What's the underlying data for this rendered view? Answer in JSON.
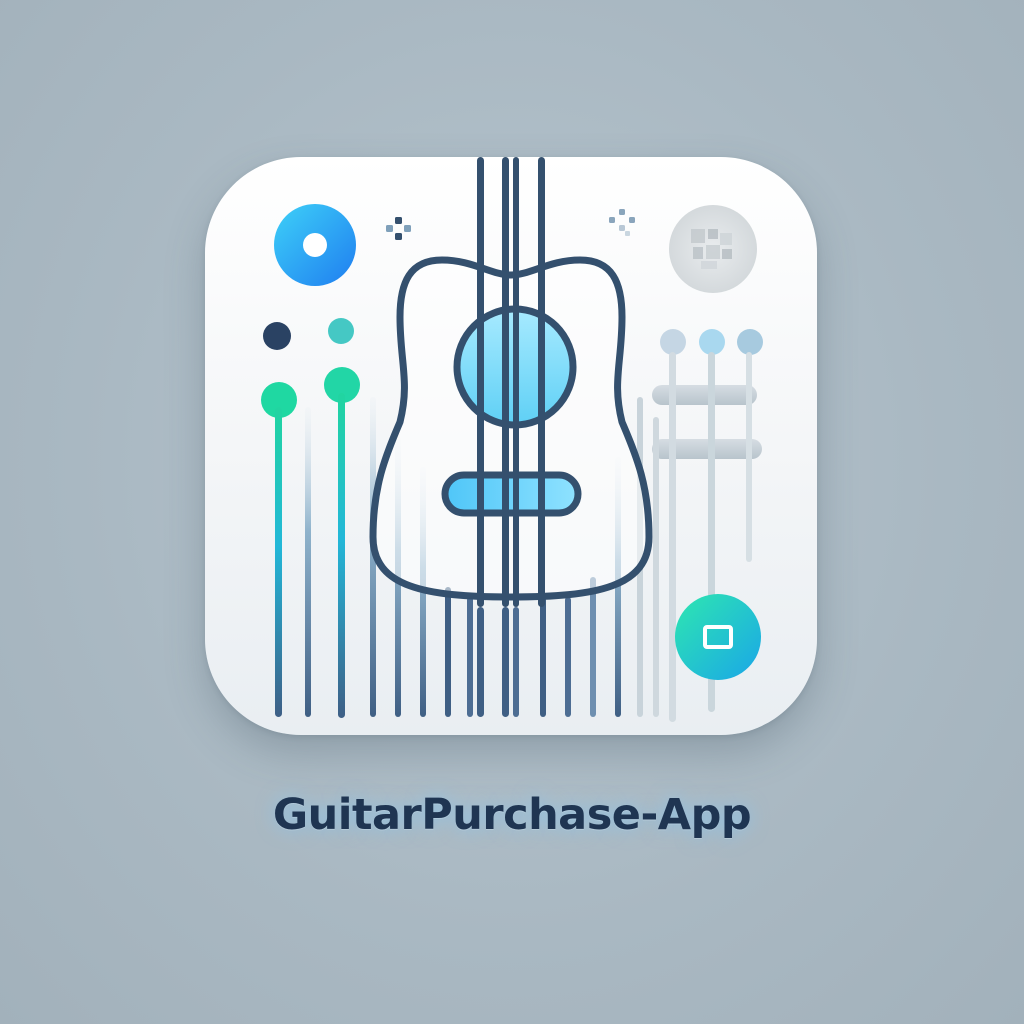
{
  "app": {
    "name": "GuitarPurchase-App"
  },
  "colors": {
    "background": "#a9b8c2",
    "tile": "#ffffff",
    "outline": "#34506e",
    "accent_blue": "#27a3f5",
    "accent_green": "#1fd3a5",
    "accent_teal": "#48c1c9",
    "muted_gray": "#c7d0d6",
    "title_text": "#1f3552"
  },
  "icons": {
    "main": "acoustic-guitar-icon",
    "top_left": "record-disc-icon",
    "top_right": "qr-code-icon",
    "bottom_right": "square-button-icon",
    "sparkles": "sparkle-icon",
    "pegs": "tuning-pegs-icon"
  }
}
